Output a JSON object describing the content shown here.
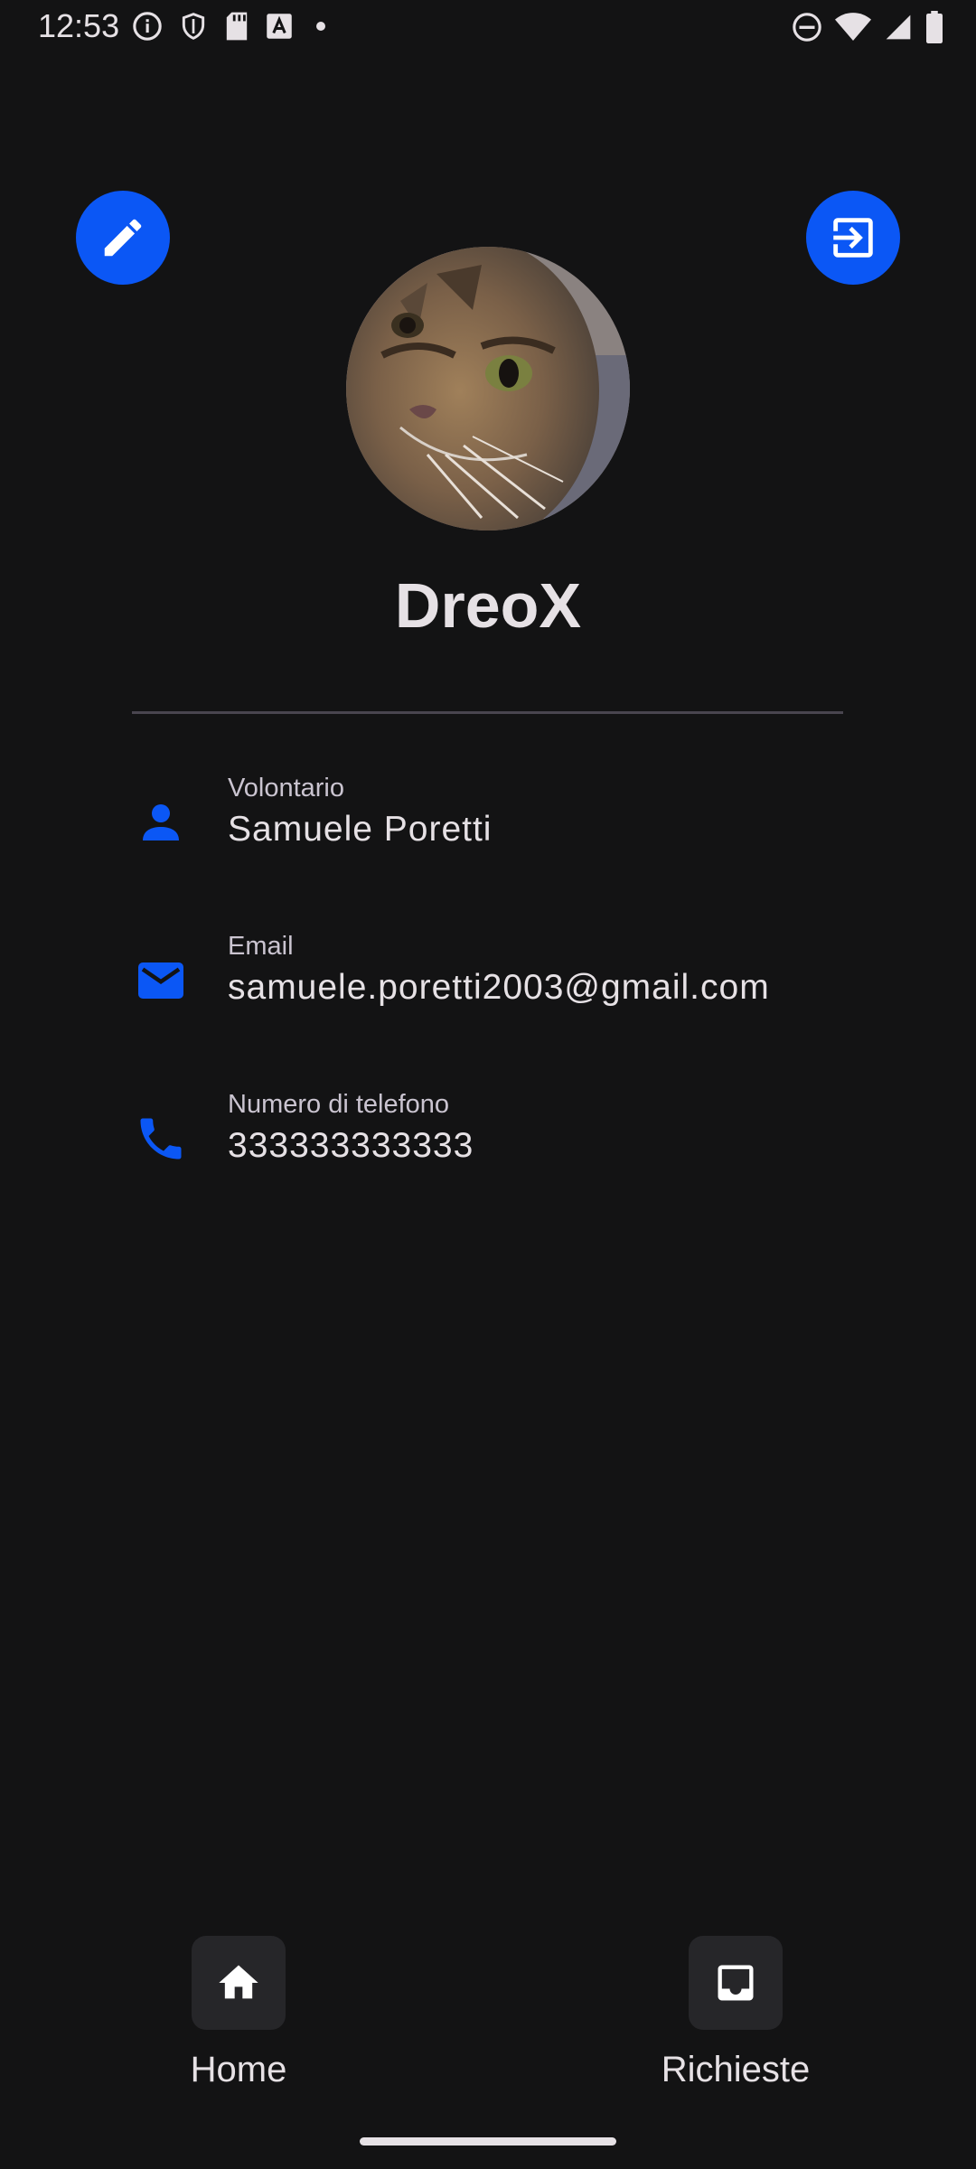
{
  "status_bar": {
    "time": "12:53",
    "icons_left": [
      "info-icon",
      "shield-icon",
      "sd-card-icon",
      "font-icon",
      "notification-dot"
    ],
    "icons_right": [
      "do-not-disturb-icon",
      "wifi-icon",
      "cell-signal-icon",
      "battery-icon"
    ]
  },
  "header": {
    "edit_icon": "pencil-icon",
    "logout_icon": "exit-icon"
  },
  "profile": {
    "avatar": "cat-photo",
    "username": "DreoX"
  },
  "info": [
    {
      "label": "Volontario",
      "value": "Samuele Poretti",
      "icon": "person-icon"
    },
    {
      "label": "Email",
      "value": "samuele.poretti2003@gmail.com",
      "icon": "mail-icon"
    },
    {
      "label": "Numero di telefono",
      "value": "333333333333",
      "icon": "phone-icon"
    }
  ],
  "bottom_nav": {
    "items": [
      {
        "label": "Home",
        "icon": "home-icon"
      },
      {
        "label": "Richieste",
        "icon": "inbox-icon"
      }
    ]
  },
  "colors": {
    "background": "#131314",
    "accent": "#0b57f5",
    "text": "#e6e1e5"
  }
}
